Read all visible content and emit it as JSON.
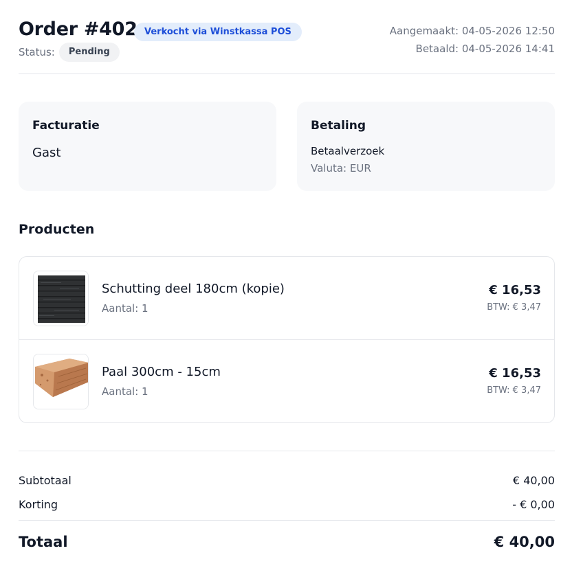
{
  "order": {
    "title": "Order #402",
    "source_badge": "Verkocht via Winstkassa POS",
    "status_label": "Status:",
    "status": "Pending",
    "created": "Aangemaakt: 04-05-2026 12:50",
    "paid": "Betaald: 04-05-2026 14:41"
  },
  "billing": {
    "title": "Facturatie",
    "name": "Gast"
  },
  "payment": {
    "title": "Betaling",
    "method": "Betaalverzoek",
    "currency": "Valuta: EUR"
  },
  "products": {
    "title": "Producten",
    "items": [
      {
        "name": "Schutting deel 180cm (kopie)",
        "qty": "Aantal: 1",
        "price": "€ 16,53",
        "tax": "BTW: € 3,47",
        "image": "dark-fence-panel"
      },
      {
        "name": "Paal 300cm - 15cm",
        "qty": "Aantal: 1",
        "price": "€ 16,53",
        "tax": "BTW: € 3,47",
        "image": "wooden-post"
      }
    ]
  },
  "summary": {
    "subtotal_label": "Subtotaal",
    "subtotal": "€ 40,00",
    "discount_label": "Korting",
    "discount": "- € 0,00",
    "total_label": "Totaal",
    "total": "€ 40,00"
  },
  "colors": {
    "accent_badge_bg": "#e3edfb",
    "accent_badge_text": "#1d4ed8",
    "card_bg": "#f7f8fa",
    "muted_text": "#6b7280"
  }
}
